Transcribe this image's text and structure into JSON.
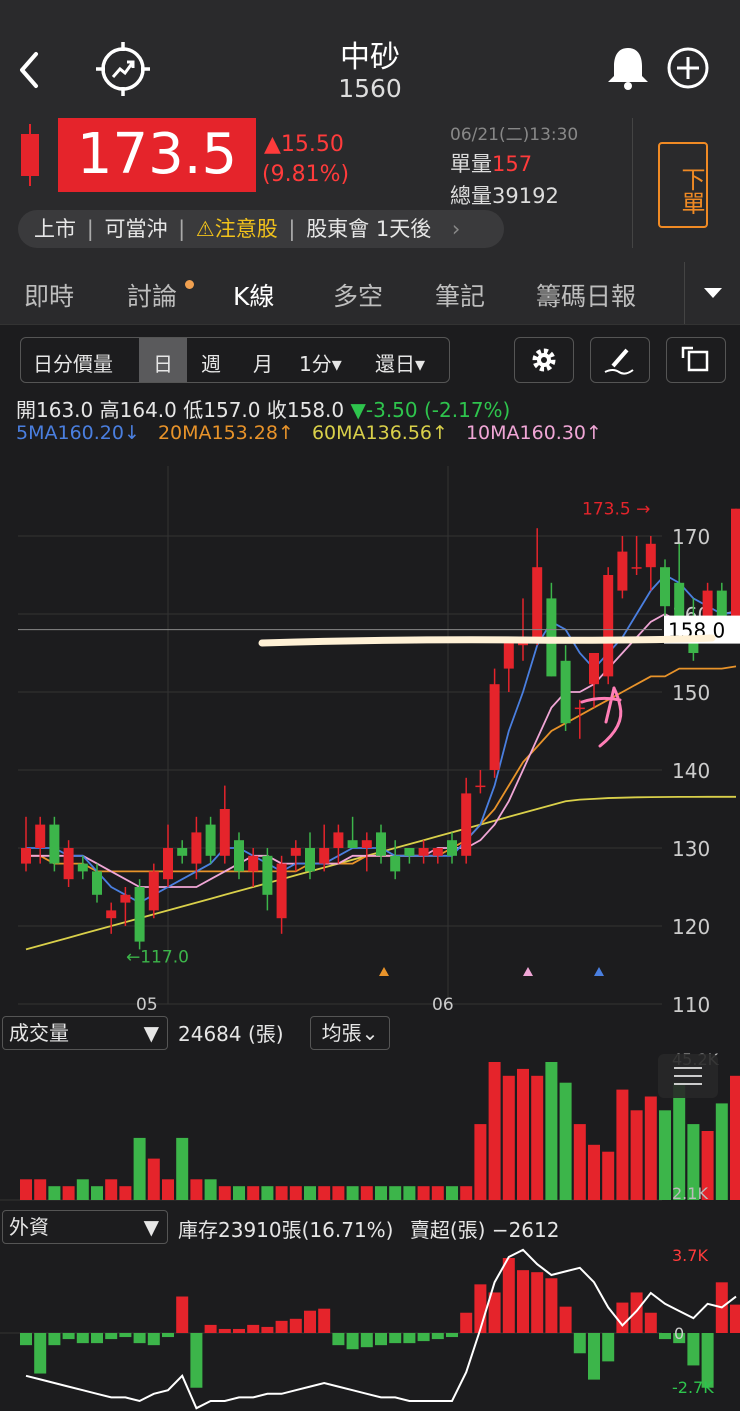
{
  "header": {
    "stock_name": "中砂",
    "stock_code": "1560",
    "back_icon": "chevron-left-icon",
    "compare_icon": "target-trend-icon",
    "bell_icon": "bell-icon",
    "add_icon": "plus-circle-icon"
  },
  "quote": {
    "price": "173.5",
    "change": "▲15.50",
    "change_pct": "(9.81%)",
    "datetime": "06/21(二)13:30",
    "unit_vol_label": "單量",
    "unit_vol": "157",
    "total_vol_label": "總量",
    "total_vol": "39192",
    "order_button": "下單"
  },
  "tags": {
    "market": "上市",
    "daytrade": "可當沖",
    "warning": "注意股",
    "meeting": "股東會 1天後"
  },
  "tabs": [
    "即時",
    "討論",
    "K線",
    "多空",
    "筆記",
    "籌碼日報"
  ],
  "active_tab": "K線",
  "period_selector": {
    "items": [
      "日分價量",
      "日",
      "週",
      "月",
      "1分▾",
      "還日▾"
    ],
    "active": "日"
  },
  "ohlc": {
    "open_label": "開",
    "open": "163.0",
    "high_label": "高",
    "high": "164.0",
    "low_label": "低",
    "low": "157.0",
    "close_label": "收",
    "close": "158.0",
    "change": "▼-3.50 (-2.17%)"
  },
  "ma_legend": {
    "ma5": "5MA160.20↓",
    "ma20": "20MA153.28↑",
    "ma60": "60MA136.56↑",
    "ma10": "10MA160.30↑"
  },
  "colors": {
    "up": "#e5242b",
    "down": "#3cb54a",
    "ma5": "#4a7fe0",
    "ma10": "#f0a6d6",
    "ma20": "#e8932a",
    "ma60": "#d9d04a",
    "annotation": "#fff1d6",
    "pink_arrow": "#ff7eb6"
  },
  "price_chart": {
    "y_ticks": [
      "170",
      "160",
      "150",
      "140",
      "130",
      "120",
      "110"
    ],
    "x_ticks": [
      "05",
      "06"
    ],
    "high_marker": "173.5",
    "low_marker": "←117.0",
    "current_price_label": "158.0"
  },
  "volume_panel": {
    "selector": "成交量",
    "value": "24684 (張)",
    "mode": "均張⌄",
    "max_label": "45.2K",
    "min_label": "2.1K"
  },
  "foreign_panel": {
    "selector": "外資",
    "holdings": "庫存23910張(16.71%)",
    "net": "賣超(張) −2612",
    "max_label": "3.7K",
    "zero_label": "0",
    "min_label": "-2.7K"
  },
  "chart_data": {
    "type": "candlestick",
    "y_range": [
      110,
      175
    ],
    "candles": [
      {
        "o": 128,
        "h": 134,
        "l": 127,
        "c": 130
      },
      {
        "o": 130,
        "h": 134,
        "l": 128,
        "c": 133
      },
      {
        "o": 133,
        "h": 134,
        "l": 127,
        "c": 128
      },
      {
        "o": 126,
        "h": 131,
        "l": 125,
        "c": 130
      },
      {
        "o": 128,
        "h": 129,
        "l": 126,
        "c": 127
      },
      {
        "o": 127,
        "h": 128,
        "l": 123,
        "c": 124
      },
      {
        "o": 121,
        "h": 123,
        "l": 119,
        "c": 122
      },
      {
        "o": 123,
        "h": 125,
        "l": 120,
        "c": 124
      },
      {
        "o": 125,
        "h": 126,
        "l": 117,
        "c": 118
      },
      {
        "o": 122,
        "h": 128,
        "l": 121,
        "c": 127
      },
      {
        "o": 126,
        "h": 133,
        "l": 125,
        "c": 130
      },
      {
        "o": 130,
        "h": 131,
        "l": 128,
        "c": 129
      },
      {
        "o": 128,
        "h": 134,
        "l": 126,
        "c": 132
      },
      {
        "o": 133,
        "h": 134,
        "l": 128,
        "c": 129
      },
      {
        "o": 129,
        "h": 138,
        "l": 128,
        "c": 135
      },
      {
        "o": 131,
        "h": 132,
        "l": 126,
        "c": 127
      },
      {
        "o": 127,
        "h": 130,
        "l": 125,
        "c": 129
      },
      {
        "o": 129,
        "h": 130,
        "l": 122,
        "c": 124
      },
      {
        "o": 121,
        "h": 129,
        "l": 119,
        "c": 128
      },
      {
        "o": 129,
        "h": 131,
        "l": 127,
        "c": 130
      },
      {
        "o": 130,
        "h": 132,
        "l": 126,
        "c": 127
      },
      {
        "o": 128,
        "h": 133,
        "l": 127,
        "c": 130
      },
      {
        "o": 130,
        "h": 133,
        "l": 128,
        "c": 132
      },
      {
        "o": 131,
        "h": 134,
        "l": 130,
        "c": 130
      },
      {
        "o": 130,
        "h": 132,
        "l": 127,
        "c": 131
      },
      {
        "o": 132,
        "h": 133,
        "l": 128,
        "c": 129
      },
      {
        "o": 129,
        "h": 131,
        "l": 126,
        "c": 127
      },
      {
        "o": 130,
        "h": 130,
        "l": 128,
        "c": 129
      },
      {
        "o": 129,
        "h": 131,
        "l": 128,
        "c": 130
      },
      {
        "o": 129,
        "h": 130,
        "l": 128,
        "c": 130
      },
      {
        "o": 131,
        "h": 132,
        "l": 128,
        "c": 129
      },
      {
        "o": 129,
        "h": 139,
        "l": 128,
        "c": 137
      },
      {
        "o": 138,
        "h": 140,
        "l": 137,
        "c": 138
      },
      {
        "o": 140,
        "h": 153,
        "l": 139,
        "c": 151
      },
      {
        "o": 153,
        "h": 157,
        "l": 150,
        "c": 157
      },
      {
        "o": 156,
        "h": 162,
        "l": 154,
        "c": 157
      },
      {
        "o": 157,
        "h": 171,
        "l": 156,
        "c": 166
      },
      {
        "o": 162,
        "h": 164,
        "l": 152,
        "c": 152
      },
      {
        "o": 154,
        "h": 156,
        "l": 145,
        "c": 146
      },
      {
        "o": 148,
        "h": 149,
        "l": 144,
        "c": 148
      },
      {
        "o": 151,
        "h": 155,
        "l": 148,
        "c": 155
      },
      {
        "o": 152,
        "h": 166,
        "l": 151,
        "c": 165
      },
      {
        "o": 163,
        "h": 170,
        "l": 162,
        "c": 168
      },
      {
        "o": 166,
        "h": 170,
        "l": 165,
        "c": 166
      },
      {
        "o": 166,
        "h": 170,
        "l": 163,
        "c": 169
      },
      {
        "o": 166,
        "h": 167,
        "l": 159,
        "c": 161
      },
      {
        "o": 164,
        "h": 169,
        "l": 158,
        "c": 159
      },
      {
        "o": 159,
        "h": 162,
        "l": 154,
        "c": 155
      },
      {
        "o": 159,
        "h": 164,
        "l": 157,
        "c": 163
      },
      {
        "o": 163,
        "h": 164,
        "l": 157,
        "c": 158
      },
      {
        "o": 158,
        "h": 173.5,
        "l": 158,
        "c": 173.5
      }
    ],
    "ma5": [
      130,
      130,
      130,
      129,
      129,
      127,
      125,
      124,
      123,
      124,
      125,
      126,
      127,
      128,
      130,
      130,
      129,
      128,
      127,
      128,
      128,
      128,
      129,
      130,
      130,
      130,
      129,
      129,
      129,
      129,
      129,
      131,
      133,
      138,
      145,
      150,
      156,
      159,
      158,
      155,
      153,
      155,
      157,
      160,
      163,
      165,
      164,
      162,
      161,
      160,
      160.2
    ],
    "ma10": [
      129,
      129,
      129,
      129,
      129,
      128,
      127,
      126,
      125,
      125,
      125,
      125,
      125,
      126,
      127,
      128,
      129,
      129,
      128,
      128,
      128,
      128,
      128,
      129,
      129,
      129,
      129,
      129,
      129,
      130,
      130,
      130,
      131,
      133,
      136,
      140,
      144,
      148,
      150,
      150,
      151,
      153,
      155,
      157,
      159,
      160,
      159,
      159,
      159,
      160,
      160.3
    ],
    "ma20": [
      129,
      129,
      128,
      128,
      128,
      127,
      127,
      127,
      127,
      127,
      127,
      127,
      127,
      127,
      127,
      127,
      127,
      127,
      127,
      127,
      128,
      128,
      128,
      128,
      129,
      129,
      129,
      129,
      129,
      129,
      130,
      131,
      133,
      135,
      138,
      141,
      143,
      145,
      146,
      147,
      148,
      149,
      150,
      151,
      152,
      152,
      153,
      153,
      153,
      153,
      153.28
    ],
    "ma60": [
      117,
      117.5,
      118,
      118.5,
      119,
      119.5,
      120,
      120.5,
      121,
      121.5,
      122,
      122.5,
      123,
      123.5,
      124,
      124.5,
      125,
      125.5,
      126,
      126.5,
      127,
      127.5,
      128,
      128.5,
      129,
      129.5,
      130,
      130.5,
      131,
      131.5,
      132,
      132.5,
      133,
      133.5,
      134,
      134.5,
      135,
      135.5,
      136,
      136.2,
      136.3,
      136.4,
      136.45,
      136.5,
      136.52,
      136.54,
      136.55,
      136.55,
      136.56,
      136.56,
      136.56
    ],
    "volume": [
      3,
      3,
      2,
      2,
      3,
      2,
      3,
      2,
      9,
      6,
      3,
      9,
      3,
      3,
      2,
      2,
      2,
      2,
      2,
      2,
      2,
      2,
      2,
      2,
      2,
      2,
      2,
      2,
      2,
      2,
      2,
      2,
      11,
      20,
      18,
      19,
      18,
      20,
      17,
      11,
      8,
      7,
      16,
      13,
      15,
      13,
      17,
      11,
      10,
      14,
      18
    ],
    "foreign": [
      -0.6,
      -2.0,
      -0.6,
      -0.3,
      -0.5,
      -0.5,
      -0.3,
      -0.2,
      -0.5,
      -0.6,
      -0.2,
      1.8,
      -2.7,
      0.4,
      0.2,
      0.2,
      0.4,
      0.3,
      0.6,
      0.7,
      1.1,
      1.2,
      -0.6,
      -0.8,
      -0.7,
      -0.6,
      -0.5,
      -0.5,
      -0.4,
      -0.3,
      -0.2,
      1.0,
      2.4,
      2.0,
      3.7,
      3.1,
      3.0,
      2.7,
      1.3,
      -1.0,
      -2.3,
      -1.4,
      1.5,
      2.0,
      1.0,
      -0.3,
      -0.5,
      -1.6,
      -2.7,
      2.5,
      1.4
    ],
    "foreign_cumulative": [
      0.2,
      0.1,
      0.0,
      -0.1,
      -0.2,
      -0.3,
      -0.4,
      -0.4,
      -0.5,
      -0.3,
      -0.2,
      0.2,
      -0.7,
      -0.5,
      -0.5,
      -0.4,
      -0.4,
      -0.3,
      -0.3,
      -0.2,
      -0.1,
      0.0,
      -0.1,
      -0.2,
      -0.3,
      -0.4,
      -0.4,
      -0.5,
      -0.5,
      -0.5,
      -0.5,
      0.3,
      1.5,
      2.8,
      3.5,
      3.7,
      3.3,
      3.0,
      3.1,
      3.2,
      2.8,
      2.1,
      1.6,
      2.0,
      2.5,
      2.2,
      2.0,
      1.8,
      2.2,
      2.1,
      2.4
    ]
  }
}
